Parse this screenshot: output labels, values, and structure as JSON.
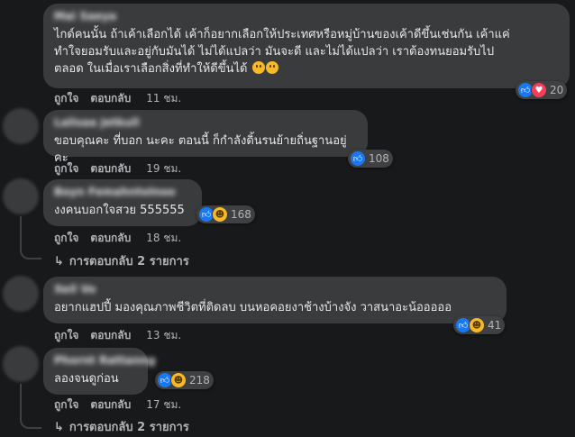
{
  "comments": [
    {
      "name": "Mai Saeya",
      "text_lines": [
        "ไกด์คนนั้น ถ้าเค้าเลือกได้ เค้าก็อยากเลือกให้ประเทศหรือหมู่บ้านของเค้าดีขึ้นเช่นกัน เค้าแค่",
        "ทำใจยอมรับและอยู่กับมันได้ ไม่ได้แปลว่า มันจะดี และไม่ได้แปลว่า เราต้องทนยอมรับไป",
        "ตลอด ในเมื่อเราเลือกสิ่งที่ทำให้ดีขึ้นได้"
      ],
      "emojis": [
        "thinking-face-icon",
        "thinking-face-icon"
      ],
      "reactions": [
        "like",
        "love"
      ],
      "reaction_count": "20",
      "like_label": "ถูกใจ",
      "reply_label": "ตอบกลับ",
      "time": "11 ชม."
    },
    {
      "name": "Lalisaa Jetkull",
      "text_lines": [
        "ขอบคุณคะ ที่บอก นะคะ ตอนนี้ ก็กำลังดิ้นรนย้ายถิ่นฐานอยู่คะ"
      ],
      "emojis": [],
      "reactions": [
        "like"
      ],
      "reaction_count": "108",
      "like_label": "ถูกใจ",
      "reply_label": "ตอบกลับ",
      "time": "19 ชม."
    },
    {
      "name": "Boyn Femahntolnoo",
      "text_lines": [
        "งงคนบอกใจสวย 555555"
      ],
      "emojis": [],
      "reactions": [
        "like",
        "haha"
      ],
      "reaction_count": "168",
      "like_label": "ถูกใจ",
      "reply_label": "ตอบกลับ",
      "time": "18 ชม.",
      "replies_label": "การตอบกลับ 2 รายการ"
    },
    {
      "name": "Xeil Vo",
      "text_lines": [
        "อยากแฮปปี้ มองคุณภาพชีวิตที่ติดลบ บนหอคอยงาช้างบ้างจัง วาสนาอะน้อออออ"
      ],
      "emojis": [],
      "reactions": [
        "like",
        "haha"
      ],
      "reaction_count": "41",
      "like_label": "ถูกใจ",
      "reply_label": "ตอบกลับ",
      "time": "13 ชม."
    },
    {
      "name": "Phornt Rattanng",
      "text_lines": [
        "ลองจนดูก่อน"
      ],
      "emojis": [],
      "reactions": [
        "like",
        "haha"
      ],
      "reaction_count": "218",
      "like_label": "ถูกใจ",
      "reply_label": "ตอบกลับ",
      "time": "17 ชม.",
      "replies_label": "การตอบกลับ 2 รายการ"
    }
  ],
  "colors": {
    "background": "#18191a",
    "bubble": "#3a3b3c",
    "text": "#e4e6eb",
    "muted": "#b0b3b8",
    "like": "#1877f2",
    "love": "#f33e58",
    "haha": "#f7b928"
  }
}
